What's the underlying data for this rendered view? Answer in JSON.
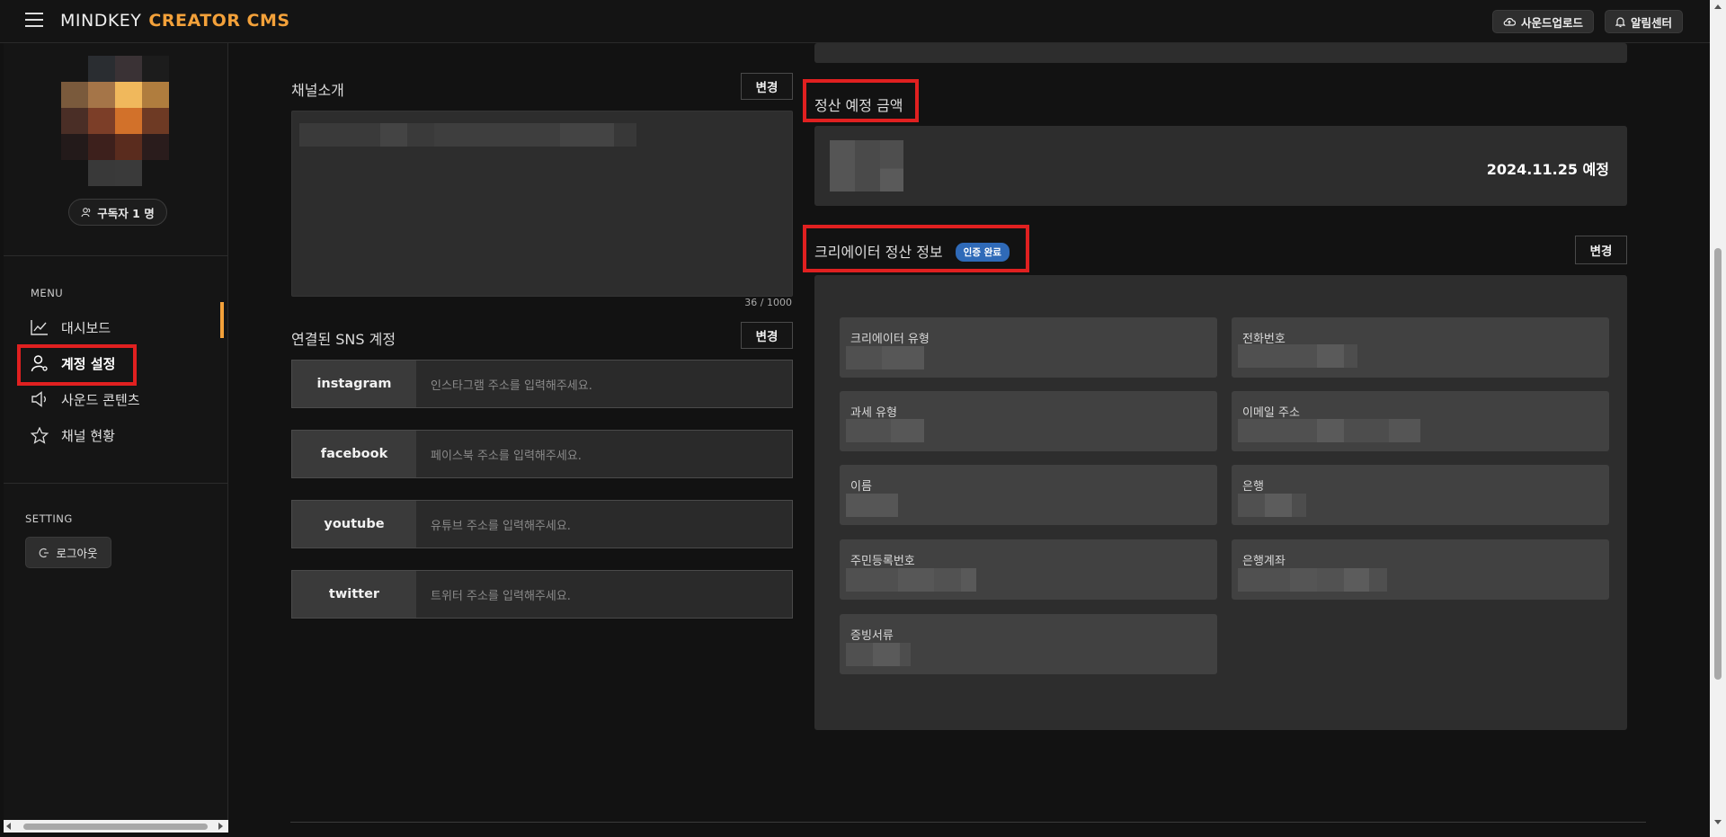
{
  "header": {
    "menu_icon": "hamburger-icon",
    "brand_primary": "MINDKEY",
    "brand_secondary": "CREATOR CMS",
    "sound_upload_label": "사운드업로드",
    "notification_label": "알림센터"
  },
  "sidebar": {
    "subscriber_label": "구독자 1 명",
    "menu_title": "MENU",
    "menu_items": [
      {
        "label": "대시보드",
        "icon": "chart-line-icon"
      },
      {
        "label": "계정 설정",
        "icon": "user-settings-icon"
      },
      {
        "label": "사운드 콘텐츠",
        "icon": "speaker-icon"
      },
      {
        "label": "채널 현황",
        "icon": "star-icon"
      }
    ],
    "setting_title": "SETTING",
    "logout_label": "로그아웃"
  },
  "channel_intro": {
    "title": "채널소개",
    "change_label": "변경",
    "counter": "36 / 1000"
  },
  "sns": {
    "title": "연결된 SNS 계정",
    "change_label": "변경",
    "rows": [
      {
        "label": "instagram",
        "placeholder": "인스타그램 주소를 입력해주세요."
      },
      {
        "label": "facebook",
        "placeholder": "페이스북 주소를 입력해주세요."
      },
      {
        "label": "youtube",
        "placeholder": "유튜브 주소를 입력해주세요."
      },
      {
        "label": "twitter",
        "placeholder": "트위터 주소를 입력해주세요."
      }
    ]
  },
  "settlement": {
    "title": "정산 예정 금액",
    "date": "2024.11.25 예정"
  },
  "creator_info": {
    "title": "크리에이터 정산 정보",
    "badge": "인증 완료",
    "change_label": "변경",
    "fields": [
      {
        "label": "크리에이터 유형"
      },
      {
        "label": "전화번호"
      },
      {
        "label": "과세 유형"
      },
      {
        "label": "이메일 주소"
      },
      {
        "label": "이름"
      },
      {
        "label": "은행"
      },
      {
        "label": "주민등록번호"
      },
      {
        "label": "은행계좌"
      },
      {
        "label": "증빙서류"
      }
    ]
  },
  "colors": {
    "accent": "#f3a13a",
    "badge": "#2f6ab8",
    "highlight": "#e02020"
  }
}
